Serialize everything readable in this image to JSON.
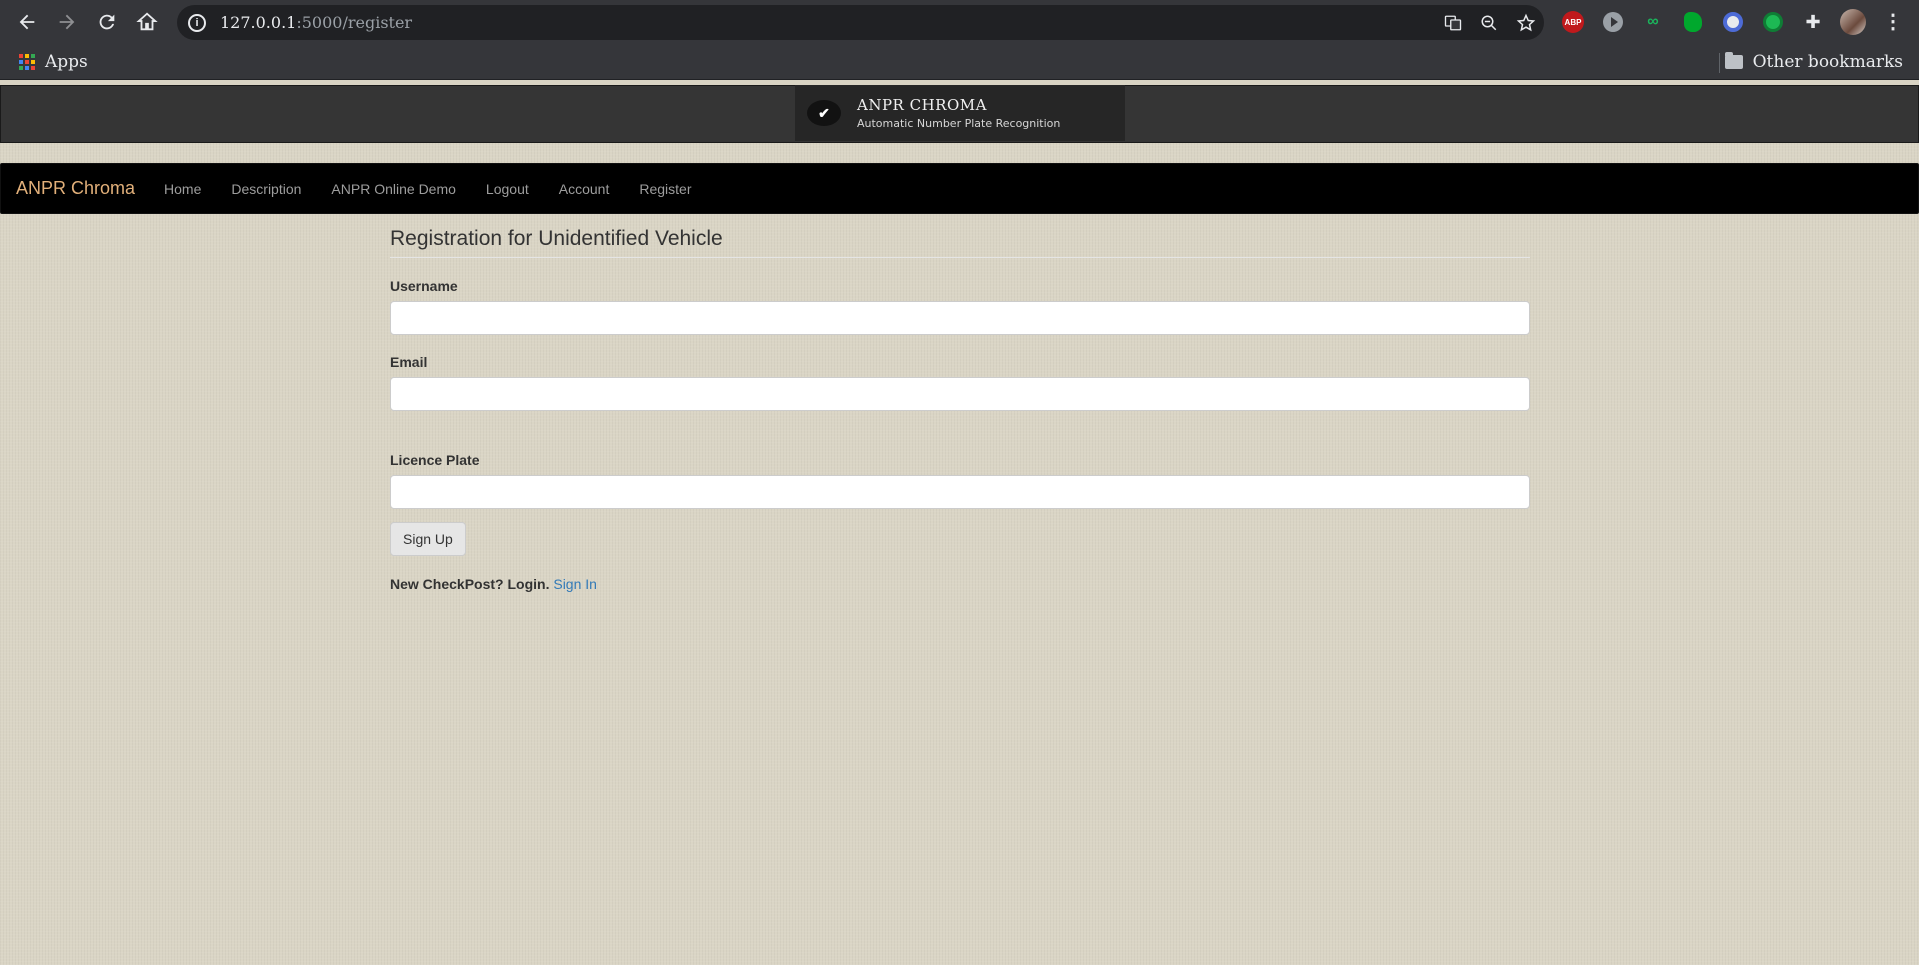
{
  "browser": {
    "url_host": "127.0.0.1",
    "url_path": ":5000/register",
    "apps_label": "Apps",
    "other_bookmarks_label": "Other bookmarks",
    "icons": [
      "back-icon",
      "forward-icon",
      "reload-icon",
      "home-icon",
      "info-icon",
      "translate-icon",
      "zoom-out-icon",
      "star-icon",
      "adblock-icon",
      "play-icon",
      "glasses-icon",
      "evernote-icon",
      "block-icon",
      "green-circle-icon",
      "puzzle-icon",
      "avatar",
      "menu-dots-icon"
    ]
  },
  "banner": {
    "title": "ANPR CHROMA",
    "subtitle": "Automatic Number Plate Recognition"
  },
  "navbar": {
    "brand": "ANPR Chroma",
    "links": [
      "Home",
      "Description",
      "ANPR Online Demo",
      "Logout",
      "Account",
      "Register"
    ]
  },
  "form": {
    "heading": "Registration for Unidentified Vehicle",
    "username_label": "Username",
    "username_value": "",
    "email_label": "Email",
    "email_value": "",
    "plate_label": "Licence Plate",
    "plate_value": "",
    "submit_label": "Sign Up",
    "signin_prompt": "New CheckPost? Login.",
    "signin_link": "Sign In"
  },
  "colors": {
    "brand": "#e2b07a",
    "link": "#337ab7",
    "page_bg": "#dad5c5",
    "navbar_bg": "#000000"
  }
}
